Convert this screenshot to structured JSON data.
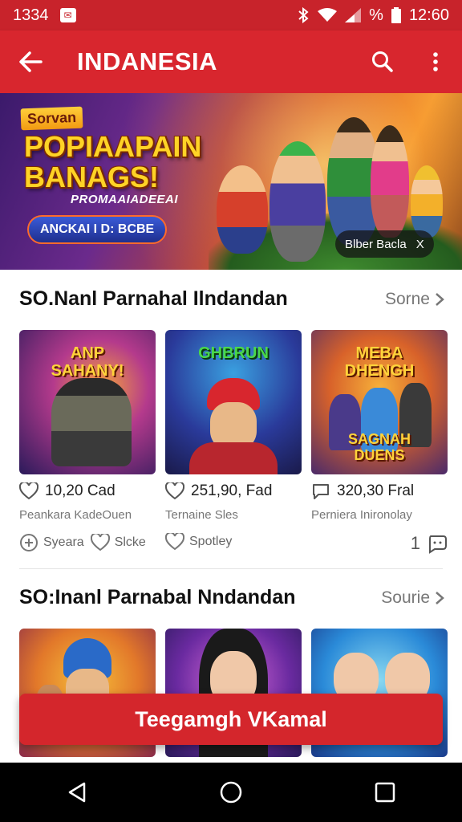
{
  "status_bar": {
    "left_text": "1334",
    "time": "12:60",
    "battery_label": "%",
    "icons": [
      "message-icon",
      "bluetooth-icon",
      "wifi-icon",
      "signal-icon",
      "battery-icon"
    ]
  },
  "app_bar": {
    "title": "INDANESIA",
    "icons": [
      "back-arrow-icon",
      "search-icon",
      "more-vert-icon"
    ]
  },
  "banner": {
    "tag": "Sorvan",
    "headline": "POPIAAPAIN\nBANAGS!",
    "subheadline": "PROMAAIADEEAI",
    "cta_label": "ANCKAI I D: BCBE",
    "chip_label": "Blber Bacla",
    "chip_close": "X"
  },
  "sections": [
    {
      "title": "SO.Nanl Parnahal Ilndandan",
      "more_label": "Sorne",
      "cards": [
        {
          "thumb_title": "ANP\nSAHANY!",
          "thumb_sub": "",
          "stat": "10,20 Cad",
          "stat_icon": "heart-icon",
          "subtitle": "Peankara KadeOuen",
          "meta": [
            {
              "icon": "plus-circle-icon",
              "label": "Syeara"
            },
            {
              "icon": "heart-icon",
              "label": "Slcke"
            }
          ]
        },
        {
          "thumb_title": "GHBRUN",
          "thumb_sub": "",
          "stat": "251,90, Fad",
          "stat_icon": "heart-icon",
          "subtitle": "Ternaine Sles",
          "meta": [
            {
              "icon": "heart-icon",
              "label": "Spotley"
            }
          ]
        },
        {
          "thumb_title": "MEBA\nDHENGH",
          "thumb_sub": "SAGNAH\nDUENS",
          "stat": "320,30 Fral",
          "stat_icon": "comment-icon",
          "subtitle": "Perniera Inironolay",
          "meta_count": "1",
          "meta_icon": "chat-face-icon"
        }
      ]
    },
    {
      "title": "SO:Inanl Parnabal Nndandan",
      "more_label": "Sourie",
      "cards": [
        {
          "thumb_title": "",
          "thumb_sub": ""
        },
        {
          "thumb_title": "",
          "thumb_sub": ""
        },
        {
          "thumb_title": "",
          "thumb_sub": ""
        }
      ]
    }
  ],
  "bottom_button": {
    "label": "Teegamgh VKamal"
  },
  "nav_bar": {
    "icons": [
      "back-triangle-icon",
      "home-circle-icon",
      "recents-square-icon"
    ]
  },
  "colors": {
    "primary": "#d8262e",
    "status_bar": "#c8232b",
    "accent_yellow": "#ffd326",
    "nav_bar": "#000000"
  }
}
